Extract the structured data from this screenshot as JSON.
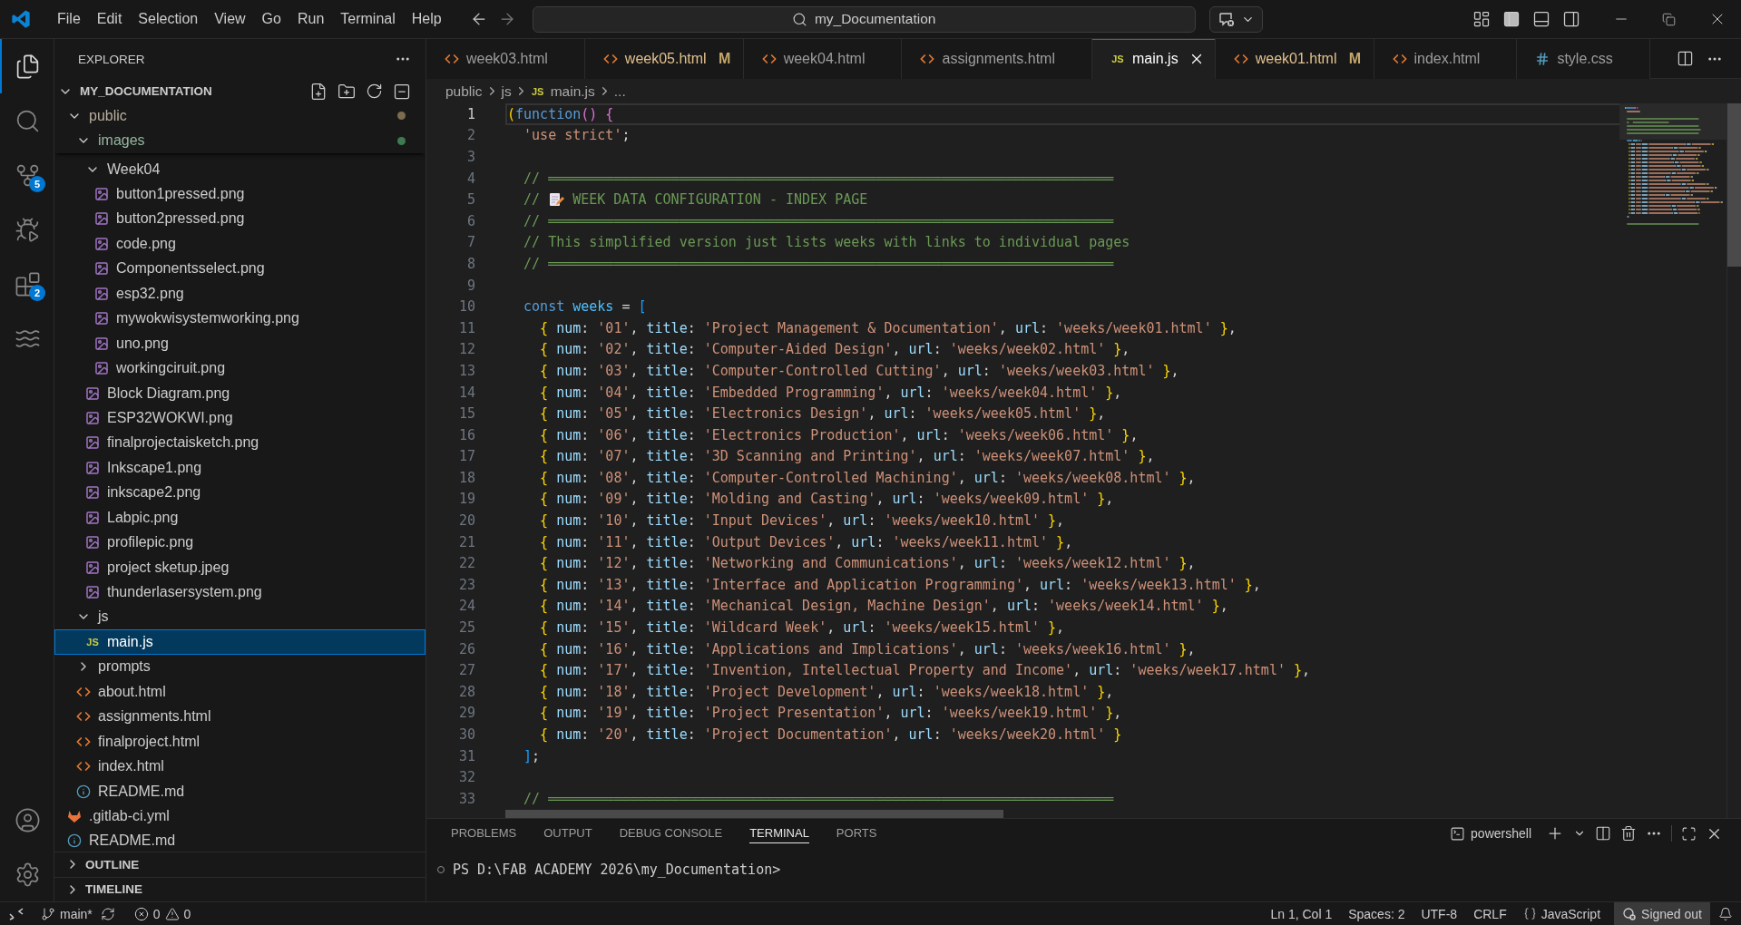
{
  "title_bar": {
    "menu": [
      "File",
      "Edit",
      "Selection",
      "View",
      "Go",
      "Run",
      "Terminal",
      "Help"
    ],
    "command_center": "my_Documentation"
  },
  "activity_bar": {
    "items": [
      {
        "kind": "explorer",
        "selected": true
      },
      {
        "kind": "search",
        "selected": false
      },
      {
        "kind": "source_control",
        "selected": false,
        "badge": "5"
      },
      {
        "kind": "run_debug",
        "selected": false
      },
      {
        "kind": "extensions",
        "selected": false,
        "badge": "2"
      },
      {
        "kind": "waves",
        "selected": false
      }
    ],
    "bottom": [
      {
        "kind": "account"
      },
      {
        "kind": "settings"
      }
    ]
  },
  "explorer": {
    "title": "EXPLORER",
    "root": {
      "label": "MY_DOCUMENTATION",
      "expanded": true
    },
    "tree": [
      {
        "label": "public",
        "kind": "folder",
        "expanded": true,
        "selected": false,
        "color": "#7d6b4f",
        "children": [
          {
            "label": "images",
            "kind": "folder",
            "expanded": true,
            "selected": false,
            "color": "#3e7a52",
            "children": [
              {
                "label": "Week04",
                "kind": "folder",
                "expanded": true,
                "selected": false,
                "children": [
                  {
                    "label": "button1pressed.png",
                    "kind": "image",
                    "selected": false
                  },
                  {
                    "label": "button2pressed.png",
                    "kind": "image",
                    "selected": false
                  },
                  {
                    "label": "code.png",
                    "kind": "image",
                    "selected": false
                  },
                  {
                    "label": "Componentsselect.png",
                    "kind": "image",
                    "selected": false
                  },
                  {
                    "label": "esp32.png",
                    "kind": "image",
                    "selected": false
                  },
                  {
                    "label": "mywokwisystemworking.png",
                    "kind": "image",
                    "selected": false
                  },
                  {
                    "label": "uno.png",
                    "kind": "image",
                    "selected": false
                  },
                  {
                    "label": "workingciruit.png",
                    "kind": "image",
                    "selected": false
                  }
                ]
              },
              {
                "label": "Block Diagram.png",
                "kind": "image",
                "selected": false
              },
              {
                "label": "ESP32WOKWI.png",
                "kind": "image",
                "selected": false
              },
              {
                "label": "finalprojectaisketch.png",
                "kind": "image",
                "selected": false
              },
              {
                "label": "Inkscape1.png",
                "kind": "image",
                "selected": false
              },
              {
                "label": "inkscape2.png",
                "kind": "image",
                "selected": false
              },
              {
                "label": "Labpic.png",
                "kind": "image",
                "selected": false
              },
              {
                "label": "profilepic.png",
                "kind": "image",
                "selected": false
              },
              {
                "label": "project sketup.jpeg",
                "kind": "image",
                "selected": false
              },
              {
                "label": "thunderlasersystem.png",
                "kind": "image",
                "selected": false
              }
            ]
          },
          {
            "label": "js",
            "kind": "folder",
            "expanded": true,
            "selected": false,
            "children": [
              {
                "label": "main.js",
                "kind": "js",
                "icon_text": "JS",
                "selected": true
              }
            ]
          },
          {
            "label": "prompts",
            "kind": "folder",
            "expanded": false,
            "selected": false
          },
          {
            "label": "about.html",
            "kind": "html",
            "selected": false
          },
          {
            "label": "assignments.html",
            "kind": "html",
            "selected": false
          },
          {
            "label": "finalproject.html",
            "kind": "html",
            "selected": false
          },
          {
            "label": "index.html",
            "kind": "html",
            "selected": false
          },
          {
            "label": "README.md",
            "kind": "markdown",
            "selected": false
          }
        ]
      },
      {
        "label": ".gitlab-ci.yml",
        "kind": "gitlab",
        "selected": false
      },
      {
        "label": "README.md",
        "kind": "markdown",
        "selected": false
      }
    ],
    "sections": [
      {
        "label": "OUTLINE",
        "expanded": false
      },
      {
        "label": "TIMELINE",
        "expanded": false
      }
    ]
  },
  "tabs": [
    {
      "label": "week03.html",
      "kind": "html",
      "selected": false,
      "modified": false
    },
    {
      "label": "week05.html",
      "kind": "html",
      "selected": false,
      "modified": true,
      "badge": "M"
    },
    {
      "label": "week04.html",
      "kind": "html",
      "selected": false,
      "modified": false
    },
    {
      "label": "assignments.html",
      "kind": "html",
      "selected": false,
      "modified": false
    },
    {
      "label": "main.js",
      "kind": "js",
      "icon_text": "JS",
      "selected": true,
      "modified": false
    },
    {
      "label": "week01.html",
      "kind": "html",
      "selected": false,
      "modified": true,
      "badge": "M"
    },
    {
      "label": "index.html",
      "kind": "html",
      "selected": false,
      "modified": false
    },
    {
      "label": "style.css",
      "kind": "css",
      "selected": false,
      "modified": false
    }
  ],
  "breadcrumb": [
    {
      "label": "public",
      "kind": "folder"
    },
    {
      "label": "js",
      "kind": "folder"
    },
    {
      "label": "main.js",
      "kind": "js",
      "icon_text": "JS"
    },
    {
      "label": "...",
      "kind": "symbol"
    }
  ],
  "editor": {
    "lines": [
      {
        "number": "1",
        "current": true,
        "tokens": [
          {
            "kind": "b1",
            "text": "("
          },
          {
            "kind": "kw",
            "text": "function"
          },
          {
            "kind": "b2",
            "text": "()"
          },
          {
            "kind": "b2",
            "text": " {"
          }
        ]
      },
      {
        "number": "2",
        "current": false,
        "tokens": [
          {
            "kind": "str",
            "text": "  'use strict'"
          },
          {
            "kind": "pl",
            "text": ";"
          }
        ]
      },
      {
        "number": "3",
        "current": false
      },
      {
        "number": "4",
        "current": false,
        "tokens": [
          {
            "kind": "com",
            "text": "  // ═════════════════════════════════════════════════════════════════════"
          }
        ]
      },
      {
        "number": "5",
        "current": false,
        "tokens": [
          {
            "kind": "com",
            "text": "  // "
          },
          {
            "kind": "icon"
          },
          {
            "kind": "com",
            "text": " WEEK DATA CONFIGURATION - INDEX PAGE"
          }
        ]
      },
      {
        "number": "6",
        "current": false,
        "tokens": [
          {
            "kind": "com",
            "text": "  // ═════════════════════════════════════════════════════════════════════"
          }
        ]
      },
      {
        "number": "7",
        "current": false,
        "tokens": [
          {
            "kind": "com",
            "text": "  // This simplified version just lists weeks with links to individual pages"
          }
        ]
      },
      {
        "number": "8",
        "current": false,
        "tokens": [
          {
            "kind": "com",
            "text": "  // ═════════════════════════════════════════════════════════════════════"
          }
        ]
      },
      {
        "number": "9",
        "current": false
      },
      {
        "number": "10",
        "current": false,
        "tokens": [
          {
            "kind": "kw",
            "text": "  const"
          },
          {
            "kind": "var",
            "text": " weeks"
          },
          {
            "kind": "pl",
            "text": " = "
          },
          {
            "kind": "b3",
            "text": "["
          }
        ]
      },
      {
        "number": "11",
        "current": false,
        "tokens": [
          {
            "kind": "b1",
            "text": "    {"
          },
          {
            "kind": "prop",
            "text": " num"
          },
          {
            "kind": "pl",
            "text": ": "
          },
          {
            "kind": "str",
            "text": "'01'"
          },
          {
            "kind": "pl",
            "text": ", "
          },
          {
            "kind": "prop",
            "text": "title"
          },
          {
            "kind": "pl",
            "text": ": "
          },
          {
            "kind": "str",
            "text": "'Project Management & Documentation'"
          },
          {
            "kind": "pl",
            "text": ", "
          },
          {
            "kind": "prop",
            "text": "url"
          },
          {
            "kind": "pl",
            "text": ": "
          },
          {
            "kind": "str",
            "text": "'weeks/week01.html'"
          },
          {
            "kind": "b1",
            "text": " }"
          },
          {
            "kind": "pl",
            "text": ","
          }
        ]
      },
      {
        "number": "12",
        "current": false,
        "tokens": [
          {
            "kind": "b1",
            "text": "    {"
          },
          {
            "kind": "prop",
            "text": " num"
          },
          {
            "kind": "pl",
            "text": ": "
          },
          {
            "kind": "str",
            "text": "'02'"
          },
          {
            "kind": "pl",
            "text": ", "
          },
          {
            "kind": "prop",
            "text": "title"
          },
          {
            "kind": "pl",
            "text": ": "
          },
          {
            "kind": "str",
            "text": "'Computer-Aided Design'"
          },
          {
            "kind": "pl",
            "text": ", "
          },
          {
            "kind": "prop",
            "text": "url"
          },
          {
            "kind": "pl",
            "text": ": "
          },
          {
            "kind": "str",
            "text": "'weeks/week02.html'"
          },
          {
            "kind": "b1",
            "text": " }"
          },
          {
            "kind": "pl",
            "text": ","
          }
        ]
      },
      {
        "number": "13",
        "current": false,
        "tokens": [
          {
            "kind": "b1",
            "text": "    {"
          },
          {
            "kind": "prop",
            "text": " num"
          },
          {
            "kind": "pl",
            "text": ": "
          },
          {
            "kind": "str",
            "text": "'03'"
          },
          {
            "kind": "pl",
            "text": ", "
          },
          {
            "kind": "prop",
            "text": "title"
          },
          {
            "kind": "pl",
            "text": ": "
          },
          {
            "kind": "str",
            "text": "'Computer-Controlled Cutting'"
          },
          {
            "kind": "pl",
            "text": ", "
          },
          {
            "kind": "prop",
            "text": "url"
          },
          {
            "kind": "pl",
            "text": ": "
          },
          {
            "kind": "str",
            "text": "'weeks/week03.html'"
          },
          {
            "kind": "b1",
            "text": " }"
          },
          {
            "kind": "pl",
            "text": ","
          }
        ]
      },
      {
        "number": "14",
        "current": false,
        "tokens": [
          {
            "kind": "b1",
            "text": "    {"
          },
          {
            "kind": "prop",
            "text": " num"
          },
          {
            "kind": "pl",
            "text": ": "
          },
          {
            "kind": "str",
            "text": "'04'"
          },
          {
            "kind": "pl",
            "text": ", "
          },
          {
            "kind": "prop",
            "text": "title"
          },
          {
            "kind": "pl",
            "text": ": "
          },
          {
            "kind": "str",
            "text": "'Embedded Programming'"
          },
          {
            "kind": "pl",
            "text": ", "
          },
          {
            "kind": "prop",
            "text": "url"
          },
          {
            "kind": "pl",
            "text": ": "
          },
          {
            "kind": "str",
            "text": "'weeks/week04.html'"
          },
          {
            "kind": "b1",
            "text": " }"
          },
          {
            "kind": "pl",
            "text": ","
          }
        ]
      },
      {
        "number": "15",
        "current": false,
        "tokens": [
          {
            "kind": "b1",
            "text": "    {"
          },
          {
            "kind": "prop",
            "text": " num"
          },
          {
            "kind": "pl",
            "text": ": "
          },
          {
            "kind": "str",
            "text": "'05'"
          },
          {
            "kind": "pl",
            "text": ", "
          },
          {
            "kind": "prop",
            "text": "title"
          },
          {
            "kind": "pl",
            "text": ": "
          },
          {
            "kind": "str",
            "text": "'Electronics Design'"
          },
          {
            "kind": "pl",
            "text": ", "
          },
          {
            "kind": "prop",
            "text": "url"
          },
          {
            "kind": "pl",
            "text": ": "
          },
          {
            "kind": "str",
            "text": "'weeks/week05.html'"
          },
          {
            "kind": "b1",
            "text": " }"
          },
          {
            "kind": "pl",
            "text": ","
          }
        ]
      },
      {
        "number": "16",
        "current": false,
        "tokens": [
          {
            "kind": "b1",
            "text": "    {"
          },
          {
            "kind": "prop",
            "text": " num"
          },
          {
            "kind": "pl",
            "text": ": "
          },
          {
            "kind": "str",
            "text": "'06'"
          },
          {
            "kind": "pl",
            "text": ", "
          },
          {
            "kind": "prop",
            "text": "title"
          },
          {
            "kind": "pl",
            "text": ": "
          },
          {
            "kind": "str",
            "text": "'Electronics Production'"
          },
          {
            "kind": "pl",
            "text": ", "
          },
          {
            "kind": "prop",
            "text": "url"
          },
          {
            "kind": "pl",
            "text": ": "
          },
          {
            "kind": "str",
            "text": "'weeks/week06.html'"
          },
          {
            "kind": "b1",
            "text": " }"
          },
          {
            "kind": "pl",
            "text": ","
          }
        ]
      },
      {
        "number": "17",
        "current": false,
        "tokens": [
          {
            "kind": "b1",
            "text": "    {"
          },
          {
            "kind": "prop",
            "text": " num"
          },
          {
            "kind": "pl",
            "text": ": "
          },
          {
            "kind": "str",
            "text": "'07'"
          },
          {
            "kind": "pl",
            "text": ", "
          },
          {
            "kind": "prop",
            "text": "title"
          },
          {
            "kind": "pl",
            "text": ": "
          },
          {
            "kind": "str",
            "text": "'3D Scanning and Printing'"
          },
          {
            "kind": "pl",
            "text": ", "
          },
          {
            "kind": "prop",
            "text": "url"
          },
          {
            "kind": "pl",
            "text": ": "
          },
          {
            "kind": "str",
            "text": "'weeks/week07.html'"
          },
          {
            "kind": "b1",
            "text": " }"
          },
          {
            "kind": "pl",
            "text": ","
          }
        ]
      },
      {
        "number": "18",
        "current": false,
        "tokens": [
          {
            "kind": "b1",
            "text": "    {"
          },
          {
            "kind": "prop",
            "text": " num"
          },
          {
            "kind": "pl",
            "text": ": "
          },
          {
            "kind": "str",
            "text": "'08'"
          },
          {
            "kind": "pl",
            "text": ", "
          },
          {
            "kind": "prop",
            "text": "title"
          },
          {
            "kind": "pl",
            "text": ": "
          },
          {
            "kind": "str",
            "text": "'Computer-Controlled Machining'"
          },
          {
            "kind": "pl",
            "text": ", "
          },
          {
            "kind": "prop",
            "text": "url"
          },
          {
            "kind": "pl",
            "text": ": "
          },
          {
            "kind": "str",
            "text": "'weeks/week08.html'"
          },
          {
            "kind": "b1",
            "text": " }"
          },
          {
            "kind": "pl",
            "text": ","
          }
        ]
      },
      {
        "number": "19",
        "current": false,
        "tokens": [
          {
            "kind": "b1",
            "text": "    {"
          },
          {
            "kind": "prop",
            "text": " num"
          },
          {
            "kind": "pl",
            "text": ": "
          },
          {
            "kind": "str",
            "text": "'09'"
          },
          {
            "kind": "pl",
            "text": ", "
          },
          {
            "kind": "prop",
            "text": "title"
          },
          {
            "kind": "pl",
            "text": ": "
          },
          {
            "kind": "str",
            "text": "'Molding and Casting'"
          },
          {
            "kind": "pl",
            "text": ", "
          },
          {
            "kind": "prop",
            "text": "url"
          },
          {
            "kind": "pl",
            "text": ": "
          },
          {
            "kind": "str",
            "text": "'weeks/week09.html'"
          },
          {
            "kind": "b1",
            "text": " }"
          },
          {
            "kind": "pl",
            "text": ","
          }
        ]
      },
      {
        "number": "20",
        "current": false,
        "tokens": [
          {
            "kind": "b1",
            "text": "    {"
          },
          {
            "kind": "prop",
            "text": " num"
          },
          {
            "kind": "pl",
            "text": ": "
          },
          {
            "kind": "str",
            "text": "'10'"
          },
          {
            "kind": "pl",
            "text": ", "
          },
          {
            "kind": "prop",
            "text": "title"
          },
          {
            "kind": "pl",
            "text": ": "
          },
          {
            "kind": "str",
            "text": "'Input Devices'"
          },
          {
            "kind": "pl",
            "text": ", "
          },
          {
            "kind": "prop",
            "text": "url"
          },
          {
            "kind": "pl",
            "text": ": "
          },
          {
            "kind": "str",
            "text": "'weeks/week10.html'"
          },
          {
            "kind": "b1",
            "text": " }"
          },
          {
            "kind": "pl",
            "text": ","
          }
        ]
      },
      {
        "number": "21",
        "current": false,
        "tokens": [
          {
            "kind": "b1",
            "text": "    {"
          },
          {
            "kind": "prop",
            "text": " num"
          },
          {
            "kind": "pl",
            "text": ": "
          },
          {
            "kind": "str",
            "text": "'11'"
          },
          {
            "kind": "pl",
            "text": ", "
          },
          {
            "kind": "prop",
            "text": "title"
          },
          {
            "kind": "pl",
            "text": ": "
          },
          {
            "kind": "str",
            "text": "'Output Devices'"
          },
          {
            "kind": "pl",
            "text": ", "
          },
          {
            "kind": "prop",
            "text": "url"
          },
          {
            "kind": "pl",
            "text": ": "
          },
          {
            "kind": "str",
            "text": "'weeks/week11.html'"
          },
          {
            "kind": "b1",
            "text": " }"
          },
          {
            "kind": "pl",
            "text": ","
          }
        ]
      },
      {
        "number": "22",
        "current": false,
        "tokens": [
          {
            "kind": "b1",
            "text": "    {"
          },
          {
            "kind": "prop",
            "text": " num"
          },
          {
            "kind": "pl",
            "text": ": "
          },
          {
            "kind": "str",
            "text": "'12'"
          },
          {
            "kind": "pl",
            "text": ", "
          },
          {
            "kind": "prop",
            "text": "title"
          },
          {
            "kind": "pl",
            "text": ": "
          },
          {
            "kind": "str",
            "text": "'Networking and Communications'"
          },
          {
            "kind": "pl",
            "text": ", "
          },
          {
            "kind": "prop",
            "text": "url"
          },
          {
            "kind": "pl",
            "text": ": "
          },
          {
            "kind": "str",
            "text": "'weeks/week12.html'"
          },
          {
            "kind": "b1",
            "text": " }"
          },
          {
            "kind": "pl",
            "text": ","
          }
        ]
      },
      {
        "number": "23",
        "current": false,
        "tokens": [
          {
            "kind": "b1",
            "text": "    {"
          },
          {
            "kind": "prop",
            "text": " num"
          },
          {
            "kind": "pl",
            "text": ": "
          },
          {
            "kind": "str",
            "text": "'13'"
          },
          {
            "kind": "pl",
            "text": ", "
          },
          {
            "kind": "prop",
            "text": "title"
          },
          {
            "kind": "pl",
            "text": ": "
          },
          {
            "kind": "str",
            "text": "'Interface and Application Programming'"
          },
          {
            "kind": "pl",
            "text": ", "
          },
          {
            "kind": "prop",
            "text": "url"
          },
          {
            "kind": "pl",
            "text": ": "
          },
          {
            "kind": "str",
            "text": "'weeks/week13.html'"
          },
          {
            "kind": "b1",
            "text": " }"
          },
          {
            "kind": "pl",
            "text": ","
          }
        ]
      },
      {
        "number": "24",
        "current": false,
        "tokens": [
          {
            "kind": "b1",
            "text": "    {"
          },
          {
            "kind": "prop",
            "text": " num"
          },
          {
            "kind": "pl",
            "text": ": "
          },
          {
            "kind": "str",
            "text": "'14'"
          },
          {
            "kind": "pl",
            "text": ", "
          },
          {
            "kind": "prop",
            "text": "title"
          },
          {
            "kind": "pl",
            "text": ": "
          },
          {
            "kind": "str",
            "text": "'Mechanical Design, Machine Design'"
          },
          {
            "kind": "pl",
            "text": ", "
          },
          {
            "kind": "prop",
            "text": "url"
          },
          {
            "kind": "pl",
            "text": ": "
          },
          {
            "kind": "str",
            "text": "'weeks/week14.html'"
          },
          {
            "kind": "b1",
            "text": " }"
          },
          {
            "kind": "pl",
            "text": ","
          }
        ]
      },
      {
        "number": "25",
        "current": false,
        "tokens": [
          {
            "kind": "b1",
            "text": "    {"
          },
          {
            "kind": "prop",
            "text": " num"
          },
          {
            "kind": "pl",
            "text": ": "
          },
          {
            "kind": "str",
            "text": "'15'"
          },
          {
            "kind": "pl",
            "text": ", "
          },
          {
            "kind": "prop",
            "text": "title"
          },
          {
            "kind": "pl",
            "text": ": "
          },
          {
            "kind": "str",
            "text": "'Wildcard Week'"
          },
          {
            "kind": "pl",
            "text": ", "
          },
          {
            "kind": "prop",
            "text": "url"
          },
          {
            "kind": "pl",
            "text": ": "
          },
          {
            "kind": "str",
            "text": "'weeks/week15.html'"
          },
          {
            "kind": "b1",
            "text": " }"
          },
          {
            "kind": "pl",
            "text": ","
          }
        ]
      },
      {
        "number": "26",
        "current": false,
        "tokens": [
          {
            "kind": "b1",
            "text": "    {"
          },
          {
            "kind": "prop",
            "text": " num"
          },
          {
            "kind": "pl",
            "text": ": "
          },
          {
            "kind": "str",
            "text": "'16'"
          },
          {
            "kind": "pl",
            "text": ", "
          },
          {
            "kind": "prop",
            "text": "title"
          },
          {
            "kind": "pl",
            "text": ": "
          },
          {
            "kind": "str",
            "text": "'Applications and Implications'"
          },
          {
            "kind": "pl",
            "text": ", "
          },
          {
            "kind": "prop",
            "text": "url"
          },
          {
            "kind": "pl",
            "text": ": "
          },
          {
            "kind": "str",
            "text": "'weeks/week16.html'"
          },
          {
            "kind": "b1",
            "text": " }"
          },
          {
            "kind": "pl",
            "text": ","
          }
        ]
      },
      {
        "number": "27",
        "current": false,
        "tokens": [
          {
            "kind": "b1",
            "text": "    {"
          },
          {
            "kind": "prop",
            "text": " num"
          },
          {
            "kind": "pl",
            "text": ": "
          },
          {
            "kind": "str",
            "text": "'17'"
          },
          {
            "kind": "pl",
            "text": ", "
          },
          {
            "kind": "prop",
            "text": "title"
          },
          {
            "kind": "pl",
            "text": ": "
          },
          {
            "kind": "str",
            "text": "'Invention, Intellectual Property and Income'"
          },
          {
            "kind": "pl",
            "text": ", "
          },
          {
            "kind": "prop",
            "text": "url"
          },
          {
            "kind": "pl",
            "text": ": "
          },
          {
            "kind": "str",
            "text": "'weeks/week17.html'"
          },
          {
            "kind": "b1",
            "text": " }"
          },
          {
            "kind": "pl",
            "text": ","
          }
        ]
      },
      {
        "number": "28",
        "current": false,
        "tokens": [
          {
            "kind": "b1",
            "text": "    {"
          },
          {
            "kind": "prop",
            "text": " num"
          },
          {
            "kind": "pl",
            "text": ": "
          },
          {
            "kind": "str",
            "text": "'18'"
          },
          {
            "kind": "pl",
            "text": ", "
          },
          {
            "kind": "prop",
            "text": "title"
          },
          {
            "kind": "pl",
            "text": ": "
          },
          {
            "kind": "str",
            "text": "'Project Development'"
          },
          {
            "kind": "pl",
            "text": ", "
          },
          {
            "kind": "prop",
            "text": "url"
          },
          {
            "kind": "pl",
            "text": ": "
          },
          {
            "kind": "str",
            "text": "'weeks/week18.html'"
          },
          {
            "kind": "b1",
            "text": " }"
          },
          {
            "kind": "pl",
            "text": ","
          }
        ]
      },
      {
        "number": "29",
        "current": false,
        "tokens": [
          {
            "kind": "b1",
            "text": "    {"
          },
          {
            "kind": "prop",
            "text": " num"
          },
          {
            "kind": "pl",
            "text": ": "
          },
          {
            "kind": "str",
            "text": "'19'"
          },
          {
            "kind": "pl",
            "text": ", "
          },
          {
            "kind": "prop",
            "text": "title"
          },
          {
            "kind": "pl",
            "text": ": "
          },
          {
            "kind": "str",
            "text": "'Project Presentation'"
          },
          {
            "kind": "pl",
            "text": ", "
          },
          {
            "kind": "prop",
            "text": "url"
          },
          {
            "kind": "pl",
            "text": ": "
          },
          {
            "kind": "str",
            "text": "'weeks/week19.html'"
          },
          {
            "kind": "b1",
            "text": " }"
          },
          {
            "kind": "pl",
            "text": ","
          }
        ]
      },
      {
        "number": "30",
        "current": false,
        "tokens": [
          {
            "kind": "b1",
            "text": "    {"
          },
          {
            "kind": "prop",
            "text": " num"
          },
          {
            "kind": "pl",
            "text": ": "
          },
          {
            "kind": "str",
            "text": "'20'"
          },
          {
            "kind": "pl",
            "text": ", "
          },
          {
            "kind": "prop",
            "text": "title"
          },
          {
            "kind": "pl",
            "text": ": "
          },
          {
            "kind": "str",
            "text": "'Project Documentation'"
          },
          {
            "kind": "pl",
            "text": ", "
          },
          {
            "kind": "prop",
            "text": "url"
          },
          {
            "kind": "pl",
            "text": ": "
          },
          {
            "kind": "str",
            "text": "'weeks/week20.html'"
          },
          {
            "kind": "b1",
            "text": " }"
          }
        ]
      },
      {
        "number": "31",
        "current": false,
        "tokens": [
          {
            "kind": "b3",
            "text": "  ]"
          },
          {
            "kind": "pl",
            "text": ";"
          }
        ]
      },
      {
        "number": "32",
        "current": false
      },
      {
        "number": "33",
        "current": false,
        "tokens": [
          {
            "kind": "com",
            "text": "  // ═════════════════════════════════════════════════════════════════════"
          }
        ]
      }
    ]
  },
  "panel": {
    "tabs": [
      {
        "label": "PROBLEMS",
        "selected": false
      },
      {
        "label": "OUTPUT",
        "selected": false
      },
      {
        "label": "DEBUG CONSOLE",
        "selected": false
      },
      {
        "label": "TERMINAL",
        "selected": true
      },
      {
        "label": "PORTS",
        "selected": false
      }
    ],
    "shell": "powershell",
    "terminal_lines": [
      "PS D:\\FAB ACADEMY 2026\\my_Documentation>"
    ]
  },
  "status_bar": {
    "branch": "main*",
    "errors": "0",
    "warnings": "0",
    "right": [
      {
        "kind": "text",
        "label": "Ln 1, Col 1"
      },
      {
        "kind": "text",
        "label": "Spaces: 2"
      },
      {
        "kind": "text",
        "label": "UTF-8"
      },
      {
        "kind": "text",
        "label": "CRLF"
      },
      {
        "kind": "language",
        "label": "JavaScript"
      },
      {
        "kind": "account",
        "label": "Signed out"
      }
    ]
  }
}
